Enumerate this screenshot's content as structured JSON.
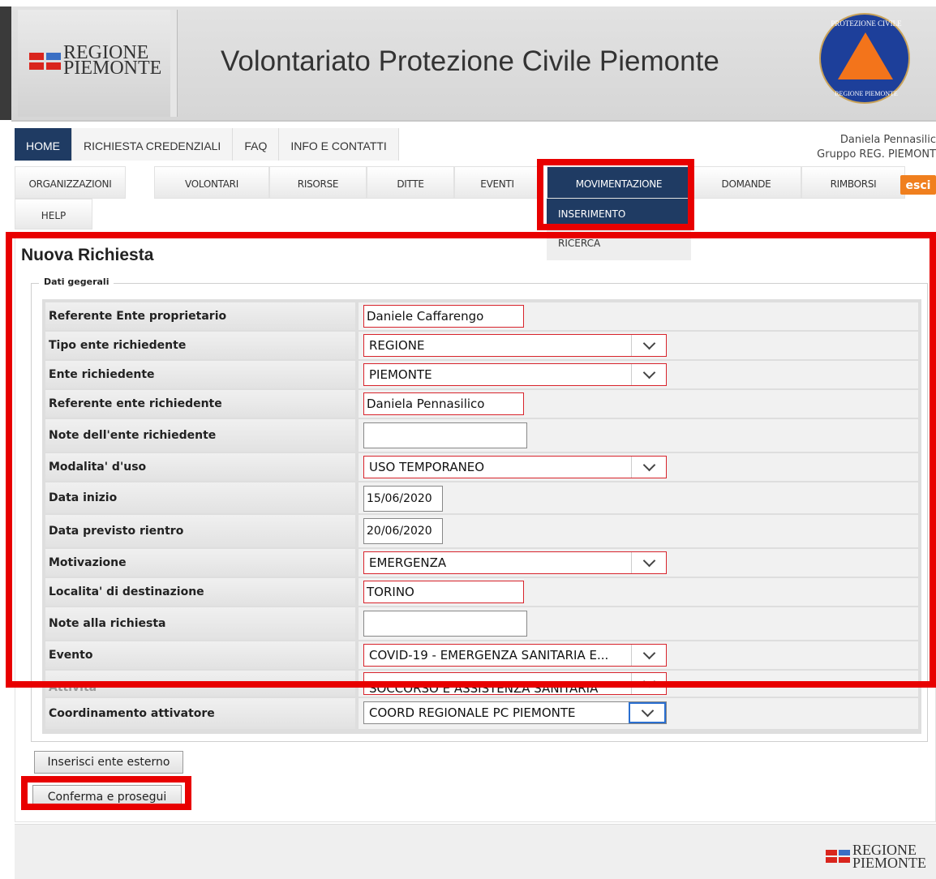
{
  "header": {
    "logo_text_line1": "REGIONE",
    "logo_text_line2": "PIEMONTE",
    "site_title": "Volontariato Protezione Civile Piemonte",
    "pc_logo_top": "PROTEZIONE CIVILE",
    "pc_logo_bottom": "REGIONE PIEMONTE"
  },
  "topnav": [
    {
      "label": "HOME",
      "active": true
    },
    {
      "label": "RICHIESTA CREDENZIALI"
    },
    {
      "label": "FAQ"
    },
    {
      "label": "INFO E CONTATTI"
    }
  ],
  "user": {
    "name": "Daniela Pennasilic",
    "group": "Gruppo REG. PIEMONT"
  },
  "subnav": [
    {
      "label": "ORGANIZZAZIONI"
    },
    {
      "label": "VOLONTARI"
    },
    {
      "label": "RISORSE"
    },
    {
      "label": "DITTE"
    },
    {
      "label": "EVENTI"
    },
    {
      "label": "MOVIMENTAZIONE",
      "active": true
    },
    {
      "label": "DOMANDE"
    },
    {
      "label": "RIMBORSI"
    }
  ],
  "esci_label": "esci",
  "help_label": "HELP",
  "dropdown": {
    "inserimento": "INSERIMENTO",
    "ricerca": "RICERCA"
  },
  "form": {
    "title": "Nuova Richiesta",
    "legend": "Dati gegerali",
    "fields": {
      "referente_proprietario": {
        "label": "Referente Ente proprietario",
        "value": "Daniele Caffarengo"
      },
      "tipo_ente": {
        "label": "Tipo ente richiedente",
        "value": "REGIONE"
      },
      "ente_richiedente": {
        "label": "Ente richiedente",
        "value": "PIEMONTE"
      },
      "referente_richiedente": {
        "label": "Referente ente richiedente",
        "value": "Daniela Pennasilico"
      },
      "note_ente": {
        "label": "Note dell'ente richiedente",
        "value": ""
      },
      "modalita_uso": {
        "label": "Modalita' d'uso",
        "value": "USO TEMPORANEO"
      },
      "data_inizio": {
        "label": "Data inizio",
        "value": "15/06/2020"
      },
      "data_rientro": {
        "label": "Data previsto rientro",
        "value": "20/06/2020"
      },
      "motivazione": {
        "label": "Motivazione",
        "value": "EMERGENZA"
      },
      "localita": {
        "label": "Localita' di destinazione",
        "value": "TORINO"
      },
      "note_richiesta": {
        "label": "Note alla richiesta",
        "value": ""
      },
      "evento": {
        "label": "Evento",
        "value": "COVID-19 - EMERGENZA SANITARIA E..."
      },
      "attivita": {
        "label": "Attivita'",
        "value": "SOCCORSO E ASSISTENZA SANITARIA"
      },
      "coordinamento": {
        "label": "Coordinamento attivatore",
        "value": "COORD REGIONALE PC PIEMONTE"
      }
    }
  },
  "buttons": {
    "inserisci_ente": "Inserisci ente esterno",
    "conferma": "Conferma e prosegui"
  },
  "colors": {
    "highlight": "#e80000",
    "nav_active": "#1f3b63",
    "esci": "#f07f1e",
    "field_border": "#d8242c"
  }
}
